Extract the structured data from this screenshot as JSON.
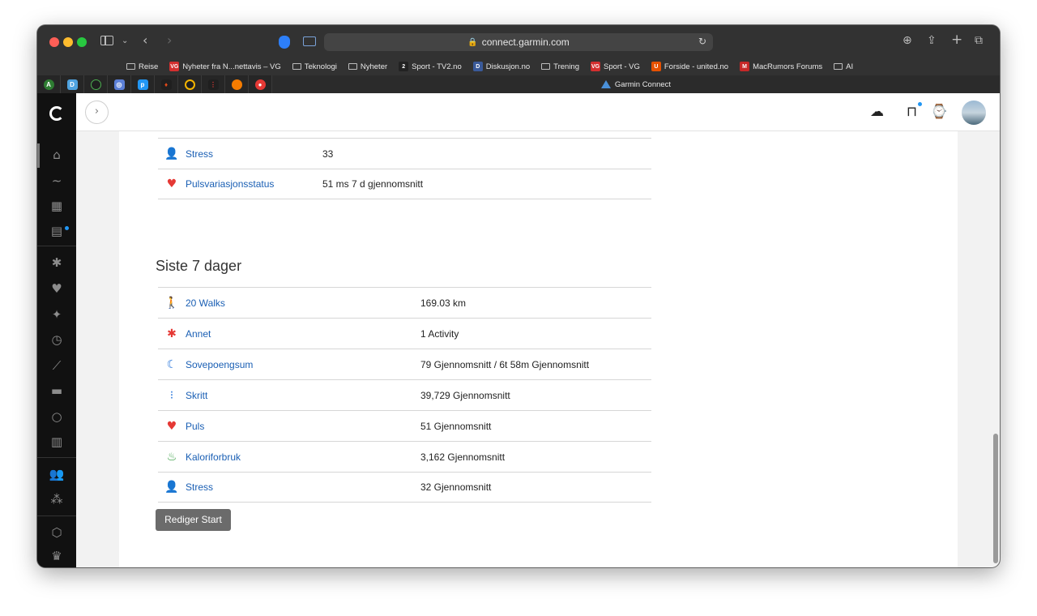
{
  "browser": {
    "url": "connect.garmin.com",
    "active_tab_title": "Garmin Connect",
    "bookmarks": [
      {
        "label": "Reise",
        "type": "folder"
      },
      {
        "label": "Nyheter fra N...nettavis – VG",
        "type": "site",
        "color": "#d32f2f",
        "fav": "VG"
      },
      {
        "label": "Teknologi",
        "type": "folder"
      },
      {
        "label": "Nyheter",
        "type": "folder"
      },
      {
        "label": "Sport - TV2.no",
        "type": "site",
        "color": "#222222",
        "fav": "2"
      },
      {
        "label": "Diskusjon.no",
        "type": "site",
        "color": "#3a5a9a",
        "fav": "D"
      },
      {
        "label": "Trening",
        "type": "folder"
      },
      {
        "label": "Sport - VG",
        "type": "site",
        "color": "#d32f2f",
        "fav": "VG"
      },
      {
        "label": "Forside - united.no",
        "type": "site",
        "color": "#e65100",
        "fav": "U"
      },
      {
        "label": "MacRumors Forums",
        "type": "site",
        "color": "#c62828",
        "fav": "M"
      },
      {
        "label": "AI",
        "type": "folder"
      }
    ]
  },
  "today_rows": [
    {
      "label": "Stress",
      "value": "33",
      "icon": "person-icon",
      "color": "#e67e22"
    },
    {
      "label": "Pulsvariasjonsstatus",
      "value": "51 ms 7 d gjennomsnitt",
      "icon": "heart-pulse-icon",
      "color": "#e53935"
    }
  ],
  "section_title": "Siste 7 dager",
  "week_rows": [
    {
      "label": "20 Walks",
      "value": "169.03 km",
      "icon": "walk-icon",
      "color": "#2e7d32"
    },
    {
      "label": "Annet",
      "value": "1 Activity",
      "icon": "activity-icon",
      "color": "#e53935"
    },
    {
      "label": "Sovepoengsum",
      "value": "79 Gjennomsnitt / 6t 58m Gjennomsnitt",
      "icon": "sleep-icon",
      "color": "#1e6fd9"
    },
    {
      "label": "Skritt",
      "value": "39,729 Gjennomsnitt",
      "icon": "footsteps-icon",
      "color": "#1e6fd9"
    },
    {
      "label": "Puls",
      "value": "51 Gjennomsnitt",
      "icon": "heart-icon",
      "color": "#e53935"
    },
    {
      "label": "Kaloriforbruk",
      "value": "3,162 Gjennomsnitt",
      "icon": "flame-icon",
      "color": "#2e9a3a"
    },
    {
      "label": "Stress",
      "value": "32 Gjennomsnitt",
      "icon": "person-icon",
      "color": "#e67e22"
    }
  ],
  "edit_button": "Rediger Start"
}
